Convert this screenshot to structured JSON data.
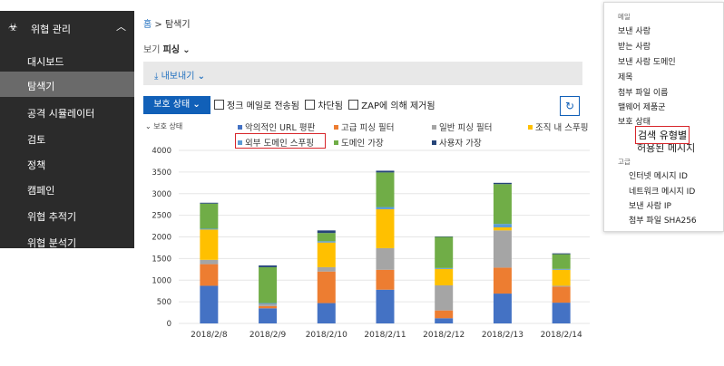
{
  "sidebar": {
    "header": "위협 관리",
    "items": [
      {
        "label": "대시보드",
        "active": false
      },
      {
        "label": "탐색기",
        "active": true
      },
      {
        "label": "공격 시뮬레이터",
        "active": false
      },
      {
        "label": "검토",
        "active": false
      },
      {
        "label": "정책",
        "active": false
      },
      {
        "label": "캠페인",
        "active": false
      },
      {
        "label": "위협 추적기",
        "active": false
      },
      {
        "label": "위협 분석기",
        "active": false
      }
    ]
  },
  "breadcrumb": {
    "home": "홈",
    "separator": ">",
    "current": "탐색기"
  },
  "view": {
    "label": "보기",
    "value": "피싱"
  },
  "export_label": "내보내기",
  "filter": {
    "status_button": "보호 상태",
    "checkboxes": [
      "정크 메일로 전송됨",
      "차단됨",
      "ZAP에 의해 제거됨"
    ]
  },
  "legend": {
    "title": "보호 상태",
    "items": [
      {
        "label": "악의적인 URL 평판",
        "color": "#4472c4"
      },
      {
        "label": "고급 피싱 필터",
        "color": "#ed7d31"
      },
      {
        "label": "일반 피싱 필터",
        "color": "#a5a5a5"
      },
      {
        "label": "조직 내 스푸핑",
        "color": "#ffc000"
      },
      {
        "label": "외부 도메인 스푸핑",
        "color": "#5b9bd5"
      },
      {
        "label": "도메인 가장",
        "color": "#70ad47"
      },
      {
        "label": "사용자 가장",
        "color": "#264478"
      }
    ]
  },
  "chart_data": {
    "type": "bar",
    "stacked": true,
    "categories": [
      "2018/2/8",
      "2018/2/9",
      "2018/2/10",
      "2018/2/11",
      "2018/2/12",
      "2018/2/13",
      "2018/2/14"
    ],
    "ylim": [
      0,
      4000
    ],
    "yticks": [
      0,
      500,
      1000,
      1500,
      2000,
      2500,
      3000,
      3500,
      4000
    ],
    "series": [
      {
        "name": "악의적인 URL 평판",
        "color": "#4472c4",
        "values": [
          870,
          350,
          470,
          780,
          120,
          690,
          480
        ]
      },
      {
        "name": "고급 피싱 필터",
        "color": "#ed7d31",
        "values": [
          500,
          50,
          730,
          460,
          180,
          600,
          370
        ]
      },
      {
        "name": "일반 피싱 필터",
        "color": "#a5a5a5",
        "values": [
          100,
          50,
          100,
          500,
          580,
          860,
          20
        ]
      },
      {
        "name": "조직 내 스푸핑",
        "color": "#ffc000",
        "values": [
          700,
          0,
          570,
          900,
          380,
          70,
          370
        ]
      },
      {
        "name": "외부 도메인 스푸핑",
        "color": "#5b9bd5",
        "values": [
          20,
          20,
          30,
          50,
          20,
          80,
          20
        ]
      },
      {
        "name": "도메인 가장",
        "color": "#70ad47",
        "values": [
          580,
          830,
          190,
          800,
          720,
          920,
          340
        ]
      },
      {
        "name": "사용자 가장",
        "color": "#264478",
        "values": [
          20,
          40,
          60,
          40,
          10,
          30,
          20
        ]
      }
    ]
  },
  "dropdown": {
    "section_mail": "메일",
    "mail_items": [
      "보낸 사람",
      "받는 사람",
      "보낸 사람 도메인",
      "제목",
      "첨부 파일 이름",
      "맬웨어 제품군",
      "보호 상태"
    ],
    "highlighted": "검색 유형별",
    "hidden_partial": "허용된 메시지",
    "section_advanced": "고급",
    "advanced_items": [
      "인터넷 메시지 ID",
      "네트워크 메시지 ID",
      "보낸 사람 IP",
      "첨부 파일 SHA256"
    ]
  }
}
